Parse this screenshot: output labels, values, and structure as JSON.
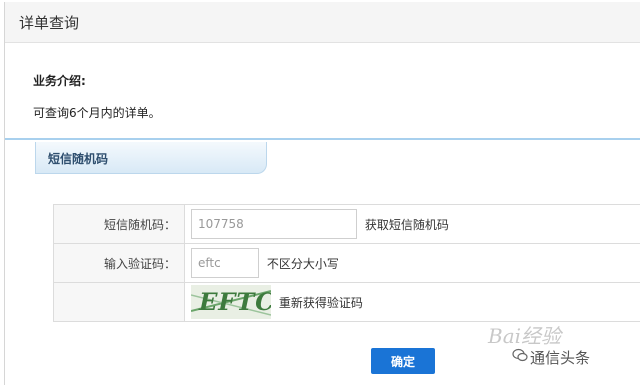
{
  "page": {
    "title": "详单查询"
  },
  "intro": {
    "heading": "业务介绍:",
    "text": "可查询6个月内的详单。"
  },
  "tab": {
    "label": "短信随机码"
  },
  "form": {
    "sms_label": "短信随机码：",
    "sms_value": "107758",
    "get_sms_link": "获取短信随机码",
    "captcha_label": "输入验证码：",
    "captcha_value": "eftc",
    "case_hint": "不区分大小写",
    "captcha_image_text": "EFTC",
    "refresh_link": "重新获得验证码"
  },
  "actions": {
    "confirm_label": "确定"
  },
  "watermark": {
    "baidu": "Bai经验",
    "source": "通信头条",
    "icon": "wechat-icon"
  },
  "colors": {
    "primary_button": "#1a74d6",
    "tab_border": "#a8d0ee"
  }
}
